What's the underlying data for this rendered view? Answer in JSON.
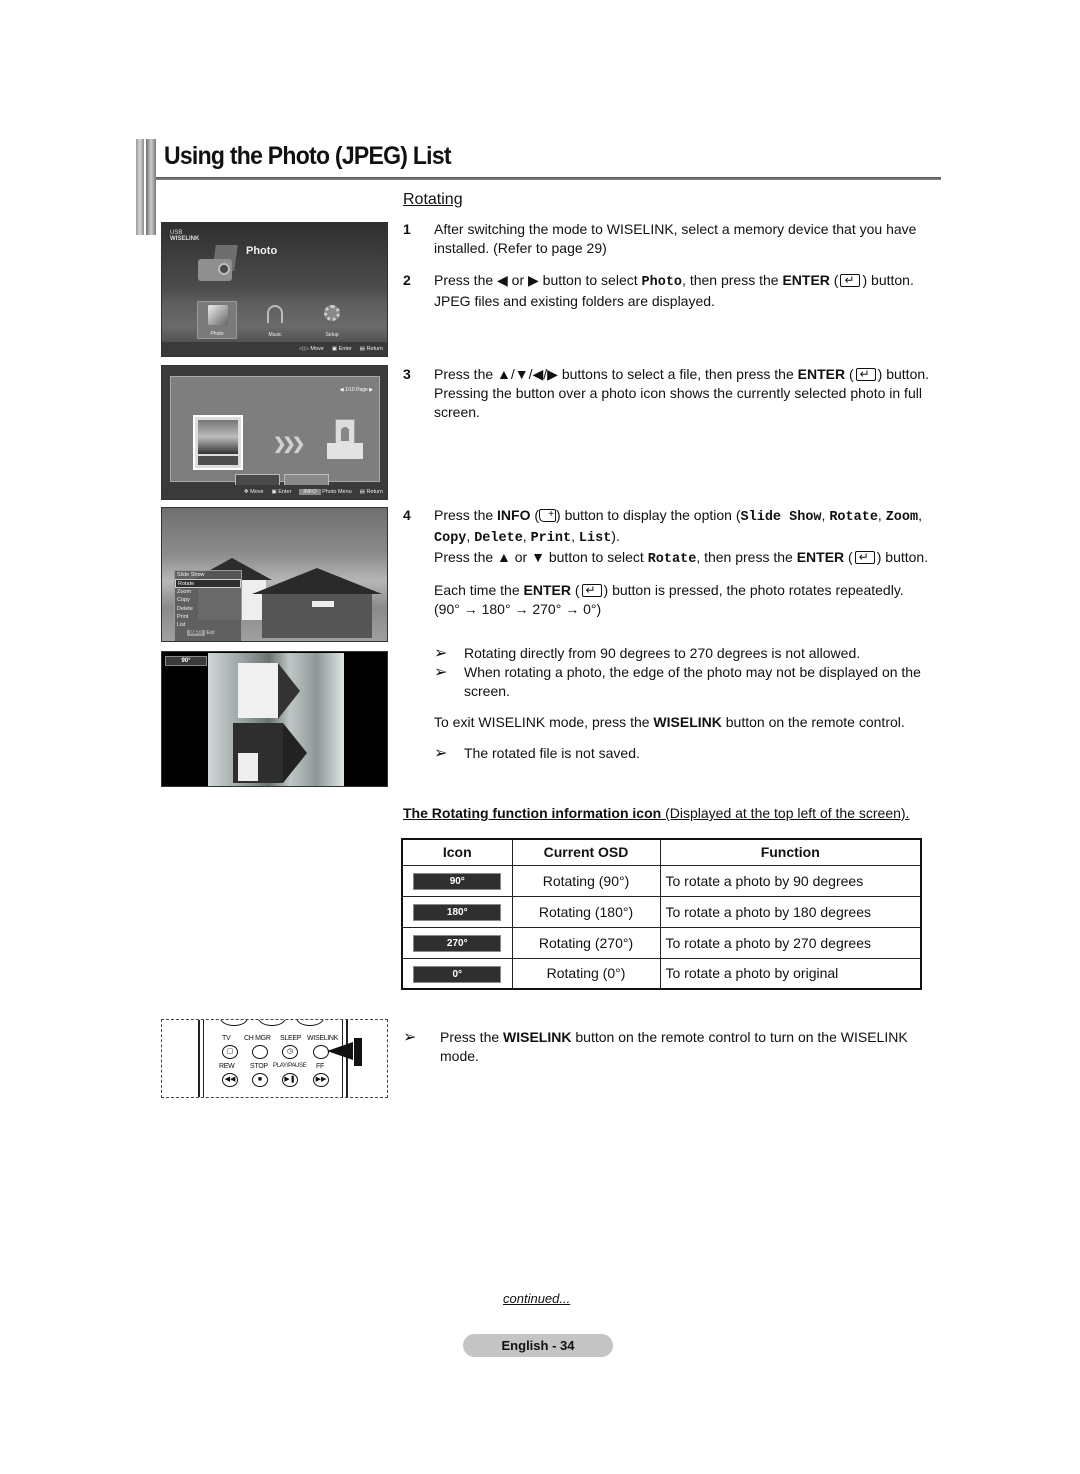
{
  "header": {
    "title": "Using the Photo (JPEG) List",
    "section": "Rotating"
  },
  "screens": {
    "wiselink_menu": {
      "brand_line1": "USB",
      "brand_line2": "WISELINK",
      "title": "Photo",
      "tiles": [
        "Photo",
        "Music",
        "Setup"
      ],
      "selected_tile": "Photo",
      "bottom_bar": [
        "◁ ▷ Move",
        "Enter",
        "Return"
      ]
    },
    "photo_list": {
      "page_indicator": "◀ 1/10 Page ▶",
      "bottom_bar": [
        "Move",
        "Enter",
        "INFO",
        "Photo Menu",
        "Return"
      ]
    },
    "option_menu": {
      "items": [
        "Slide Show",
        "Rotate",
        "Zoom",
        "Copy",
        "Delete",
        "Print",
        "List"
      ],
      "selected": "Rotate",
      "exit_key": "INFO",
      "exit_label": "Exit"
    },
    "rotated_view": {
      "badge": "90°"
    }
  },
  "steps": [
    {
      "num": "1",
      "text": "After switching the mode to WISELINK, select a memory device that you have installed. (Refer to page 29)"
    },
    {
      "num": "2",
      "pre": "Press the ◀ or ▶ button to select ",
      "code": "Photo",
      "mid": ", then press the ",
      "bold": "ENTER",
      "post": " button. JPEG files and existing folders are displayed."
    },
    {
      "num": "3",
      "pre": "Press the ▲/▼/◀/▶ buttons to select a file, then press the ",
      "bold": "ENTER",
      "post": " button. Pressing the button over a photo icon shows the currently selected photo in full screen."
    },
    {
      "num": "4",
      "pre": "Press the ",
      "bold": "INFO",
      "mid": " button to display the option (",
      "options": [
        "Slide Show",
        "Rotate",
        "Zoom",
        "Copy",
        "Delete",
        "Print",
        "List"
      ],
      "post": ").",
      "line2_pre": "Press the ▲ or ▼ button to select ",
      "line2_code": "Rotate",
      "line2_mid": ", then press the ",
      "line2_bold": "ENTER",
      "line2_post": " button.",
      "line3_pre": "Each time the ",
      "line3_bold": "ENTER",
      "line3_post": " button is pressed, the photo rotates repeatedly.",
      "sequence": "(90° → 180° → 270° → 0°)"
    }
  ],
  "notes": [
    "Rotating directly from 90 degrees to 270 degrees is not allowed.",
    "When rotating a photo, the edge of the photo may not be displayed on the screen."
  ],
  "exit_text": {
    "pre": "To exit WISELINK mode, press the ",
    "bold": "WISELINK",
    "post": " button on the remote control."
  },
  "note_not_saved": "The rotated file is not saved.",
  "table": {
    "caption_bold": "The Rotating function information icon",
    "caption_rest": " (Displayed at the top left of the screen).",
    "headers": [
      "Icon",
      "Current OSD",
      "Function"
    ],
    "rows": [
      {
        "icon": "90°",
        "osd": "Rotating (90°)",
        "function": "To rotate a photo by 90 degrees"
      },
      {
        "icon": "180°",
        "osd": "Rotating (180°)",
        "function": "To rotate a photo by 180 degrees"
      },
      {
        "icon": "270°",
        "osd": "Rotating (270°)",
        "function": "To rotate a photo by 270 degrees"
      },
      {
        "icon": "0°",
        "osd": "Rotating (0°)",
        "function": "To rotate a photo by original"
      }
    ]
  },
  "remote": {
    "row1_labels": [
      "TV",
      "CH MGR",
      "SLEEP",
      "WISELINK"
    ],
    "row2_labels": [
      "REW",
      "STOP",
      "PLAY/PAUSE",
      "FF"
    ]
  },
  "wiselink_note": {
    "pre": "Press the ",
    "bold": "WISELINK",
    "post": " button on the remote control to turn on the WISELINK mode."
  },
  "footer": {
    "continued": "continued...",
    "page": "English - 34"
  },
  "colors": {
    "osd_badge": "#2f2f2f",
    "page_pill": "#c4c4c4",
    "title_rule": "#666666"
  }
}
